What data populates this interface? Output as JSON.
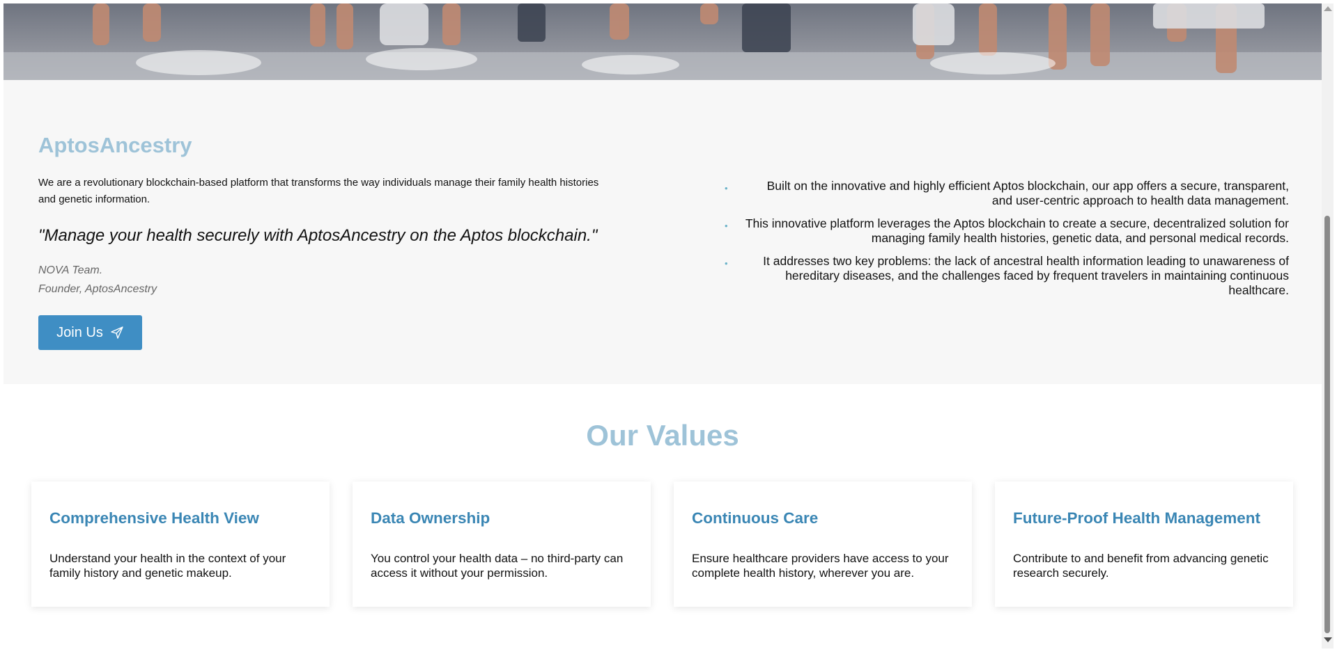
{
  "about": {
    "title": "AptosAncestry",
    "description": "We are a revolutionary blockchain-based platform that transforms the way individuals manage their family health histories and genetic information.",
    "quote": "\"Manage your health securely with AptosAncestry on the Aptos blockchain.\"",
    "author_name": "NOVA Team.",
    "author_role": "Founder, AptosAncestry",
    "join_button": "Join Us",
    "join_icon": "send-icon",
    "bullets": [
      "Built on the innovative and highly efficient Aptos blockchain, our app offers a secure, transparent, and user-centric approach to health data management.",
      "This innovative platform leverages the Aptos blockchain to create a secure, decentralized solution for managing family health histories, genetic data, and personal medical records.",
      "It addresses two key problems: the lack of ancestral health information leading to unawareness of hereditary diseases, and the challenges faced by frequent travelers in maintaining continuous healthcare."
    ]
  },
  "values": {
    "title": "Our Values",
    "cards": [
      {
        "title": "Comprehensive Health View",
        "text": "Understand your health in the context of your family history and genetic makeup."
      },
      {
        "title": "Data Ownership",
        "text": "You control your health data – no third-party can access it without your permission."
      },
      {
        "title": "Continuous Care",
        "text": "Ensure healthcare providers have access to your complete health history, wherever you are."
      },
      {
        "title": "Future-Proof Health Management",
        "text": "Contribute to and benefit from advancing genetic research securely."
      }
    ]
  },
  "colors": {
    "accent_title": "#9ec3d8",
    "button": "#3f8ec4",
    "card_title": "#3a86b4",
    "section_bg": "#f7f7f7"
  }
}
